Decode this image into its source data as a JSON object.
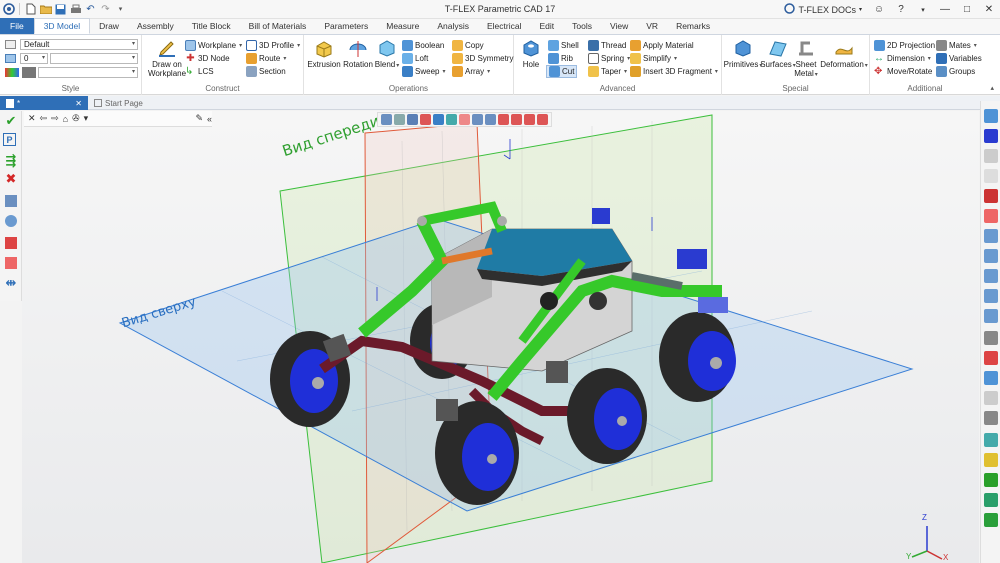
{
  "window": {
    "title": "T-FLEX Parametric CAD 17",
    "docs_label": "T-FLEX DOCs",
    "minimize": "—",
    "maximize": "□",
    "close": "✕"
  },
  "tabs": [
    "File",
    "3D Model",
    "Draw",
    "Assembly",
    "Title Block",
    "Bill of Materials",
    "Parameters",
    "Measure",
    "Analysis",
    "Electrical",
    "Edit",
    "Tools",
    "View",
    "VR",
    "Remarks"
  ],
  "active_tab": "3D Model",
  "ribbon": {
    "style": {
      "label": "Style",
      "style_value": "Default",
      "layer_value": "0",
      "color_value": ""
    },
    "construct": {
      "label": "Construct",
      "draw_on_workplane": "Draw on Workplane",
      "workplane": "Workplane",
      "node_3d": "3D Node",
      "lcs": "LCS",
      "profile_3d": "3D Profile",
      "route": "Route",
      "section": "Section"
    },
    "operations": {
      "label": "Operations",
      "extrusion": "Extrusion",
      "rotation": "Rotation",
      "blend": "Blend",
      "boolean": "Boolean",
      "loft": "Loft",
      "sweep": "Sweep",
      "copy": "Copy",
      "symmetry_3d": "3D Symmetry",
      "array": "Array"
    },
    "advanced": {
      "label": "Advanced",
      "hole": "Hole",
      "shell": "Shell",
      "rib": "Rib",
      "cut": "Cut",
      "thread": "Thread",
      "spring": "Spring",
      "taper": "Taper",
      "apply_material": "Apply Material",
      "simplify": "Simplify",
      "insert_3d_fragment": "Insert 3D Fragment"
    },
    "special": {
      "label": "Special",
      "primitives": "Primitives",
      "surfaces": "Surfaces",
      "sheet_metal_1": "Sheet",
      "sheet_metal_2": "Metal",
      "deformation": "Deformation"
    },
    "additional": {
      "label": "Additional",
      "projection_2d": "2D Projection",
      "dimension": "Dimension",
      "move_rotate": "Move/Rotate",
      "mates": "Mates",
      "variables": "Variables",
      "groups": "Groups"
    }
  },
  "doc_tabs": [
    {
      "label": "*",
      "active": true
    },
    {
      "label": "Start Page",
      "active": false
    }
  ],
  "viewport": {
    "front_view_label": "Вид спереди",
    "top_view_label": "Вид сверху",
    "axes": {
      "x": "X",
      "y": "Y",
      "z": "Z"
    }
  },
  "colors": {
    "accent": "#2f6fb7",
    "front_plane": "#3cbf3c",
    "top_plane": "#3a7fd6",
    "side_plane": "#e05a3a",
    "body_green": "#36c92a",
    "wheel_blue": "#1f2fd8",
    "tire_dark": "#2a2a2a",
    "arm_maroon": "#6b1a2a",
    "deck_teal": "#1f7ba5",
    "accept": "#2aa02a",
    "reject": "#d42828"
  }
}
